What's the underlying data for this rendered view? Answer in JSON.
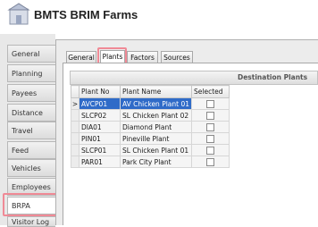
{
  "app": {
    "title": "BMTS BRIM Farms"
  },
  "sidebar": {
    "items": [
      {
        "label": "General"
      },
      {
        "label": "Planning"
      },
      {
        "label": "Payees"
      },
      {
        "label": "Distance"
      },
      {
        "label": "Travel Times"
      },
      {
        "label": "Feed Capacity"
      },
      {
        "label": "Vehicles"
      },
      {
        "label": "Employees"
      },
      {
        "label": "BRPA"
      },
      {
        "label": "Visitor Log"
      }
    ],
    "active": "BRPA"
  },
  "tabs": [
    {
      "label": "General"
    },
    {
      "label": "Plants"
    },
    {
      "label": "Factors"
    },
    {
      "label": "Sources"
    }
  ],
  "active_tab": "Plants",
  "grid": {
    "group_header": "Destination Plants",
    "columns": [
      "Plant No",
      "Plant Name",
      "Selected"
    ],
    "rows": [
      {
        "plant_no": "AVCP01",
        "plant_name": "AV Chicken Plant 01",
        "selected": false
      },
      {
        "plant_no": "SLCP02",
        "plant_name": "SL Chicken Plant 02",
        "selected": false
      },
      {
        "plant_no": "DIA01",
        "plant_name": "Diamond Plant",
        "selected": false
      },
      {
        "plant_no": "PIN01",
        "plant_name": "Pineville Plant",
        "selected": false
      },
      {
        "plant_no": "SLCP01",
        "plant_name": "SL Chicken Plant 01",
        "selected": false
      },
      {
        "plant_no": "PAR01",
        "plant_name": "Park City Plant",
        "selected": false
      }
    ],
    "current_row_indicator": ">"
  },
  "colors": {
    "selection": "#2f6bc8",
    "highlight": "#f08a96"
  }
}
